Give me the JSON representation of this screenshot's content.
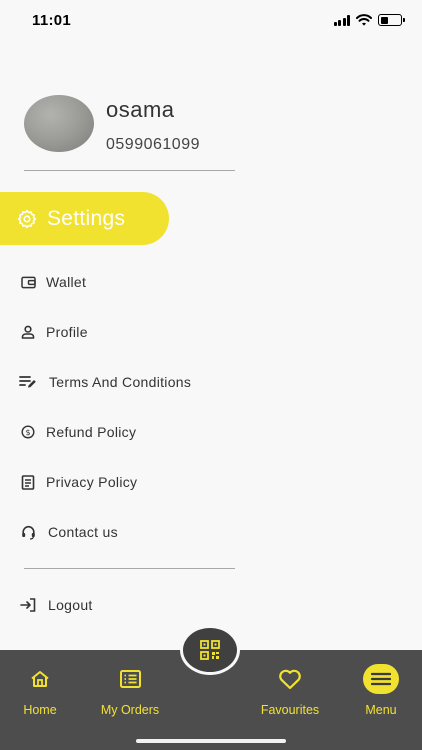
{
  "status_bar": {
    "time": "11:01"
  },
  "profile": {
    "name": "osama",
    "phone": "0599061099"
  },
  "settings": {
    "label": "Settings",
    "icon": "gear-icon"
  },
  "menu": {
    "items": [
      {
        "label": "Wallet",
        "icon": "wallet-icon"
      },
      {
        "label": "Profile",
        "icon": "person-icon"
      },
      {
        "label": "Terms And Conditions",
        "icon": "edit-list-icon"
      },
      {
        "label": "Refund Policy",
        "icon": "dollar-circle-icon"
      },
      {
        "label": "Privacy Policy",
        "icon": "document-icon"
      },
      {
        "label": "Contact us",
        "icon": "headset-icon"
      }
    ],
    "logout_label": "Logout"
  },
  "bottom_nav": {
    "items": [
      {
        "label": "Home",
        "icon": "home-icon"
      },
      {
        "label": "My Orders",
        "icon": "orders-list-icon"
      },
      {
        "label": "Favourites",
        "icon": "heart-icon"
      },
      {
        "label": "Menu",
        "icon": "hamburger-icon"
      }
    ],
    "qr_icon": "qr-code-icon"
  },
  "colors": {
    "accent": "#f1e22f",
    "nav_background": "#4d4d4d",
    "page_background": "#f8f8f8",
    "text": "#333333"
  }
}
